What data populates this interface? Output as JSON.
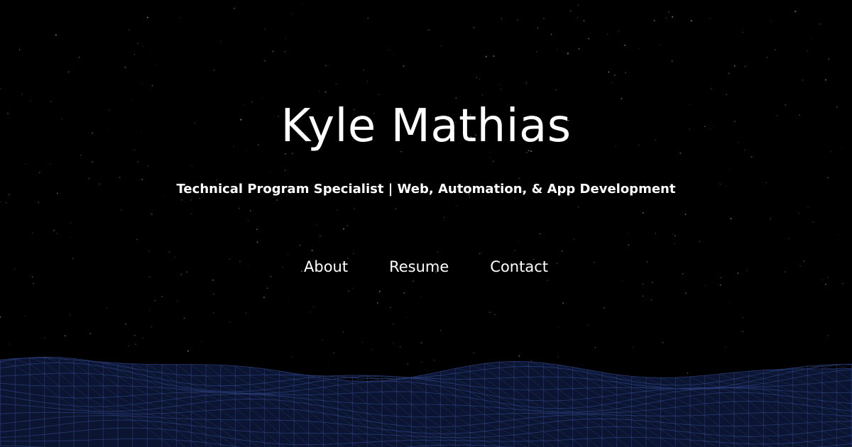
{
  "hero": {
    "title": "Kyle Mathias",
    "subtitle": "Technical Program Specialist | Web, Automation, & App Development"
  },
  "nav": {
    "items": [
      {
        "label": "About"
      },
      {
        "label": "Resume"
      },
      {
        "label": "Contact"
      }
    ]
  },
  "colors": {
    "background": "#000000",
    "text": "#ffffff",
    "terrain_fill": "#0b1430",
    "terrain_lines": "#2b3d7a",
    "stars": "#8a8a8a"
  }
}
